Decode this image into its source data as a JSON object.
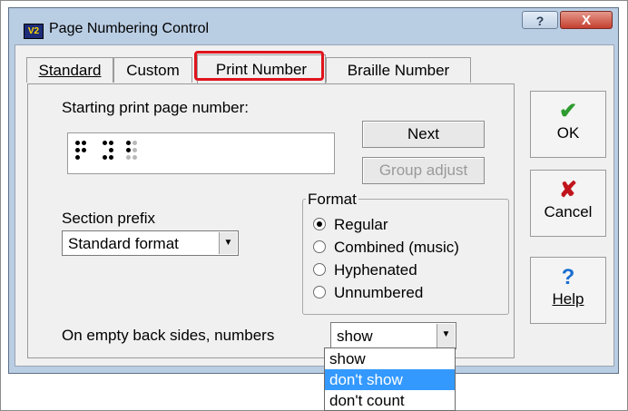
{
  "window": {
    "title": "Page Numbering Control",
    "app_icon_text": "V2",
    "help_glyph": "?",
    "close_glyph": "X"
  },
  "tabs": [
    {
      "label": "Standard",
      "active": false
    },
    {
      "label": "Custom",
      "active": false
    },
    {
      "label": "Print Number",
      "active": true
    },
    {
      "label": "Braille Number",
      "active": false
    }
  ],
  "print_number": {
    "starting_label": "Starting print page number:",
    "braille_value_icon": "braille-cells",
    "next_button": "Next",
    "group_adjust_button": "Group adjust",
    "section_prefix_label": "Section prefix",
    "section_prefix_value": "Standard format",
    "format": {
      "title": "Format",
      "options": [
        {
          "label": "Regular",
          "checked": true
        },
        {
          "label": "Combined (music)",
          "checked": false
        },
        {
          "label": "Hyphenated",
          "checked": false
        },
        {
          "label": "Unnumbered",
          "checked": false
        }
      ]
    },
    "empty_back_label": "On empty back sides, numbers",
    "empty_back_value": "show",
    "empty_back_options": [
      {
        "label": "show",
        "selected": false
      },
      {
        "label": "don't show",
        "selected": true
      },
      {
        "label": "don't count",
        "selected": false
      }
    ]
  },
  "buttons": {
    "ok": "OK",
    "cancel": "Cancel",
    "help": "Help"
  },
  "colors": {
    "ok_icon": "#2e9b2e",
    "cancel_icon": "#c0141c",
    "help_icon": "#1a6fd1",
    "highlight": "#e0141c",
    "selection": "#3399ff"
  }
}
